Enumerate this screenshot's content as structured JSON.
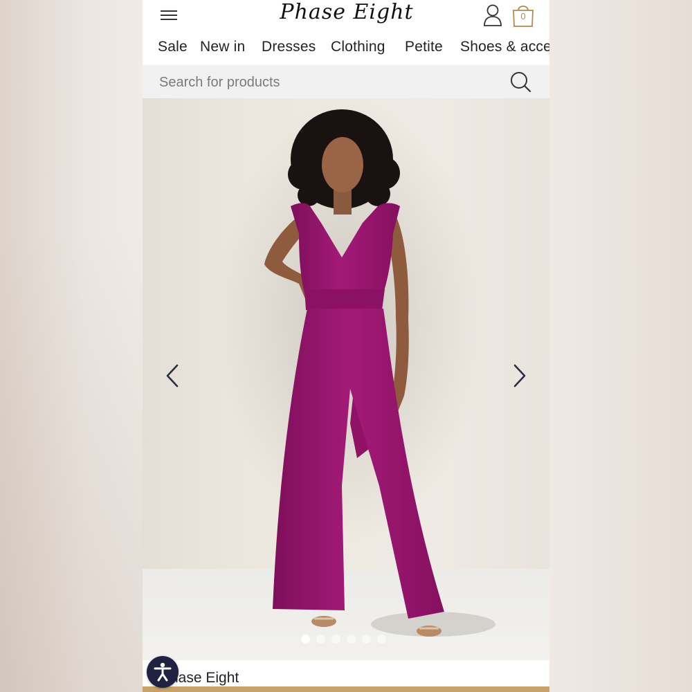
{
  "header": {
    "brand_logo": "Phase Eight",
    "bag_count": "0"
  },
  "nav": {
    "items": [
      "Sale",
      "New in",
      "Dresses",
      "Clothing",
      "Petite",
      "Shoes & acce"
    ]
  },
  "search": {
    "placeholder": "Search for products"
  },
  "carousel": {
    "slide_count": 6,
    "active_index": 0
  },
  "product": {
    "brand": "Phase Eight"
  },
  "colors": {
    "jumpsuit": "#9c1670",
    "accent_gold": "#b08a4e",
    "accessibility_button": "#1f2240"
  },
  "icons": [
    "hamburger-menu-icon",
    "account-icon",
    "shopping-bag-icon",
    "search-icon",
    "chevron-left-icon",
    "chevron-right-icon",
    "accessibility-icon"
  ]
}
